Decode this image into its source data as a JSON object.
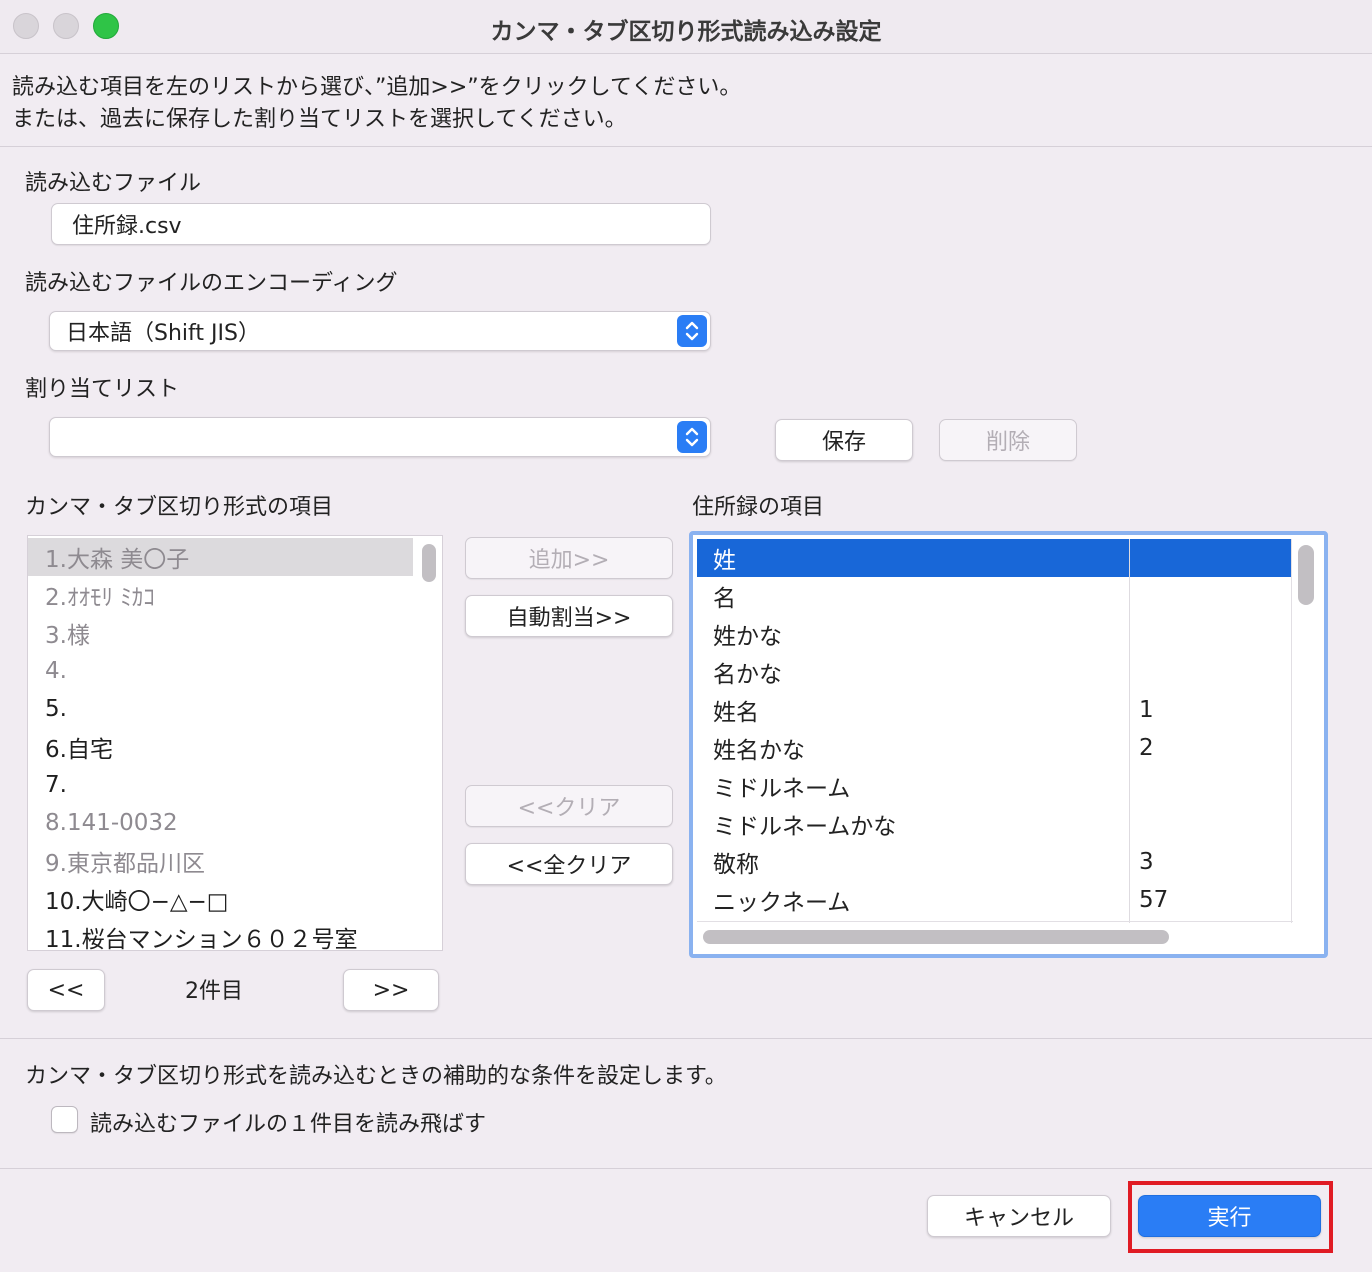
{
  "window": {
    "title": "カンマ・タブ区切り形式読み込み設定"
  },
  "instructions": {
    "line1": "読み込む項目を左のリストから選び、”追加>>”をクリックしてください。",
    "line2": "または、過去に保存した割り当てリストを選択してください。"
  },
  "file": {
    "label": "読み込むファイル",
    "value": "住所録.csv"
  },
  "encoding": {
    "label": "読み込むファイルのエンコーディング",
    "value": "日本語（Shift JIS）"
  },
  "mapping": {
    "label": "割り当てリスト",
    "value": "",
    "save_label": "保存",
    "delete_label": "削除"
  },
  "source": {
    "label": "カンマ・タブ区切り形式の項目",
    "items": [
      {
        "text": "1.大森 美〇子",
        "dim": true,
        "selected": true
      },
      {
        "text": "2.ｵｵﾓﾘ ﾐｶｺ",
        "dim": true
      },
      {
        "text": "3.様",
        "dim": true
      },
      {
        "text": "4.",
        "dim": true
      },
      {
        "text": "5.",
        "dim": false
      },
      {
        "text": "6.自宅",
        "dim": false
      },
      {
        "text": "7.",
        "dim": false
      },
      {
        "text": "8.141-0032",
        "dim": true
      },
      {
        "text": "9.東京都品川区",
        "dim": true
      },
      {
        "text": "10.大崎〇−△−□",
        "dim": false
      },
      {
        "text": "11.桜台マンション６０２号室",
        "dim": false
      }
    ],
    "prev_label": "<<",
    "page_label": "2件目",
    "next_label": ">>"
  },
  "actions": {
    "add_label": "追加>>",
    "auto_label": "自動割当>>",
    "clear_label": "<<クリア",
    "clear_all_label": "<<全クリア"
  },
  "target": {
    "label": "住所録の項目",
    "rows": [
      {
        "name": "姓",
        "value": "",
        "selected": true
      },
      {
        "name": "名",
        "value": ""
      },
      {
        "name": "姓かな",
        "value": ""
      },
      {
        "name": "名かな",
        "value": ""
      },
      {
        "name": "姓名",
        "value": "1"
      },
      {
        "name": "姓名かな",
        "value": "2"
      },
      {
        "name": "ミドルネーム",
        "value": ""
      },
      {
        "name": "ミドルネームかな",
        "value": ""
      },
      {
        "name": "敬称",
        "value": "3"
      },
      {
        "name": "ニックネーム",
        "value": "57"
      }
    ]
  },
  "options": {
    "description": "カンマ・タブ区切り形式を読み込むときの補助的な条件を設定します。",
    "skip_first_label": "読み込むファイルの１件目を読み飛ばす",
    "skip_first_checked": false
  },
  "footer": {
    "cancel_label": "キャンセル",
    "run_label": "実行"
  },
  "colors": {
    "accent": "#2a7df5",
    "selection": "#1867d8",
    "highlight": "#e01b24",
    "dim_text": "#8e8a90"
  }
}
